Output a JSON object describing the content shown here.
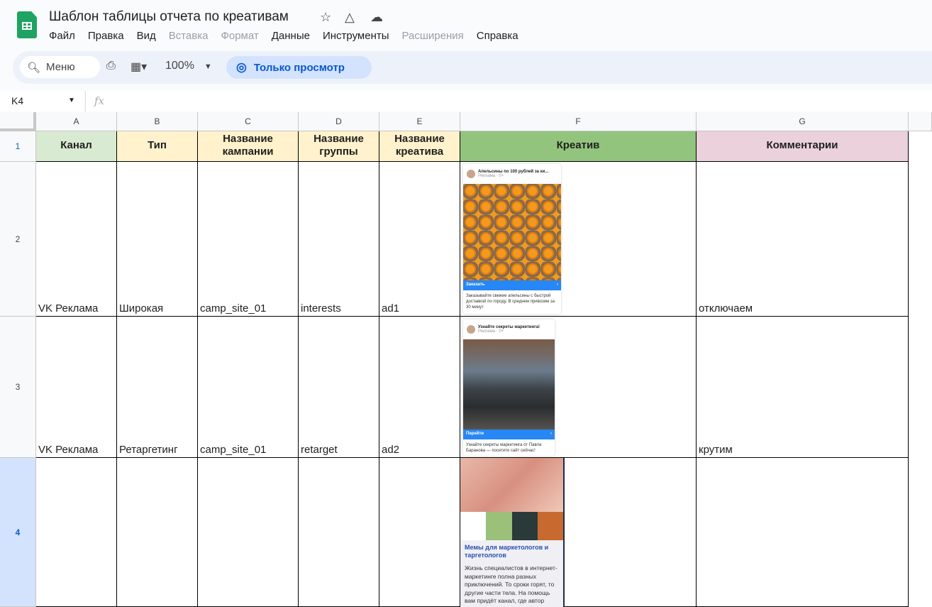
{
  "app": {
    "title": "Шаблон таблицы отчета по креативам",
    "icons": [
      "star-icon",
      "move-to-drive-icon",
      "cloud-saved-icon"
    ]
  },
  "menu": [
    {
      "label": "Файл",
      "enabled": true
    },
    {
      "label": "Правка",
      "enabled": true
    },
    {
      "label": "Вид",
      "enabled": true
    },
    {
      "label": "Вставка",
      "enabled": false
    },
    {
      "label": "Формат",
      "enabled": false
    },
    {
      "label": "Данные",
      "enabled": true
    },
    {
      "label": "Инструменты",
      "enabled": true
    },
    {
      "label": "Расширения",
      "enabled": false
    },
    {
      "label": "Справка",
      "enabled": true
    }
  ],
  "toolbar": {
    "search_label": "Меню",
    "zoom": "100%",
    "view_only": "Только просмотр"
  },
  "formula_bar": {
    "name_box": "K4",
    "fx": "fx",
    "value": ""
  },
  "columns": [
    "A",
    "B",
    "C",
    "D",
    "E",
    "F",
    "G"
  ],
  "rows": [
    "1",
    "2",
    "3",
    "4"
  ],
  "selected_row": "4",
  "header_row": [
    "Канал",
    "Тип",
    "Название кампании",
    "Название группы",
    "Название креатива",
    "Креатив",
    "Комментарии"
  ],
  "header_colors": [
    "#d9ead3",
    "#fff2cc",
    "#fff2cc",
    "#fff2cc",
    "#fff2cc",
    "#93c47d",
    "#ead1dc"
  ],
  "data_rows": [
    {
      "channel": "VK Реклама",
      "type": "Широкая",
      "campaign": "camp_site_01",
      "group": "interests",
      "creative_name": "ad1",
      "comment": "отключаем",
      "creative": {
        "headline": "Апельсины по 100 рублей за ки...",
        "sub": "Реклама · 0+",
        "button": "Заказать",
        "text": "Заказывайте свежие апельсины с быстрой доставкой по городу. В среднем привозим за 30 минут"
      }
    },
    {
      "channel": "VK Реклама",
      "type": "Ретаргетинг",
      "campaign": "camp_site_01",
      "group": "retarget",
      "creative_name": "ad2",
      "comment": "крутим",
      "creative": {
        "headline": "Узнайте секреты маркетинга!",
        "sub": "Реклама · 0+",
        "button": "Перейти",
        "text": "Узнайте секреты маркетинга от Павла Баранова — посетите сайт сейчас!"
      }
    },
    {
      "channel": "",
      "type": "",
      "campaign": "",
      "group": "",
      "creative_name": "",
      "comment": "",
      "creative": {
        "headline": "Мемы для маркетологов и таргетологов",
        "text": "Жизнь специалистов в интернет-маркетинге полна разных приключений. То сроки горят, то другие части тела. На помощь вам придёт канал, где автор"
      }
    }
  ]
}
